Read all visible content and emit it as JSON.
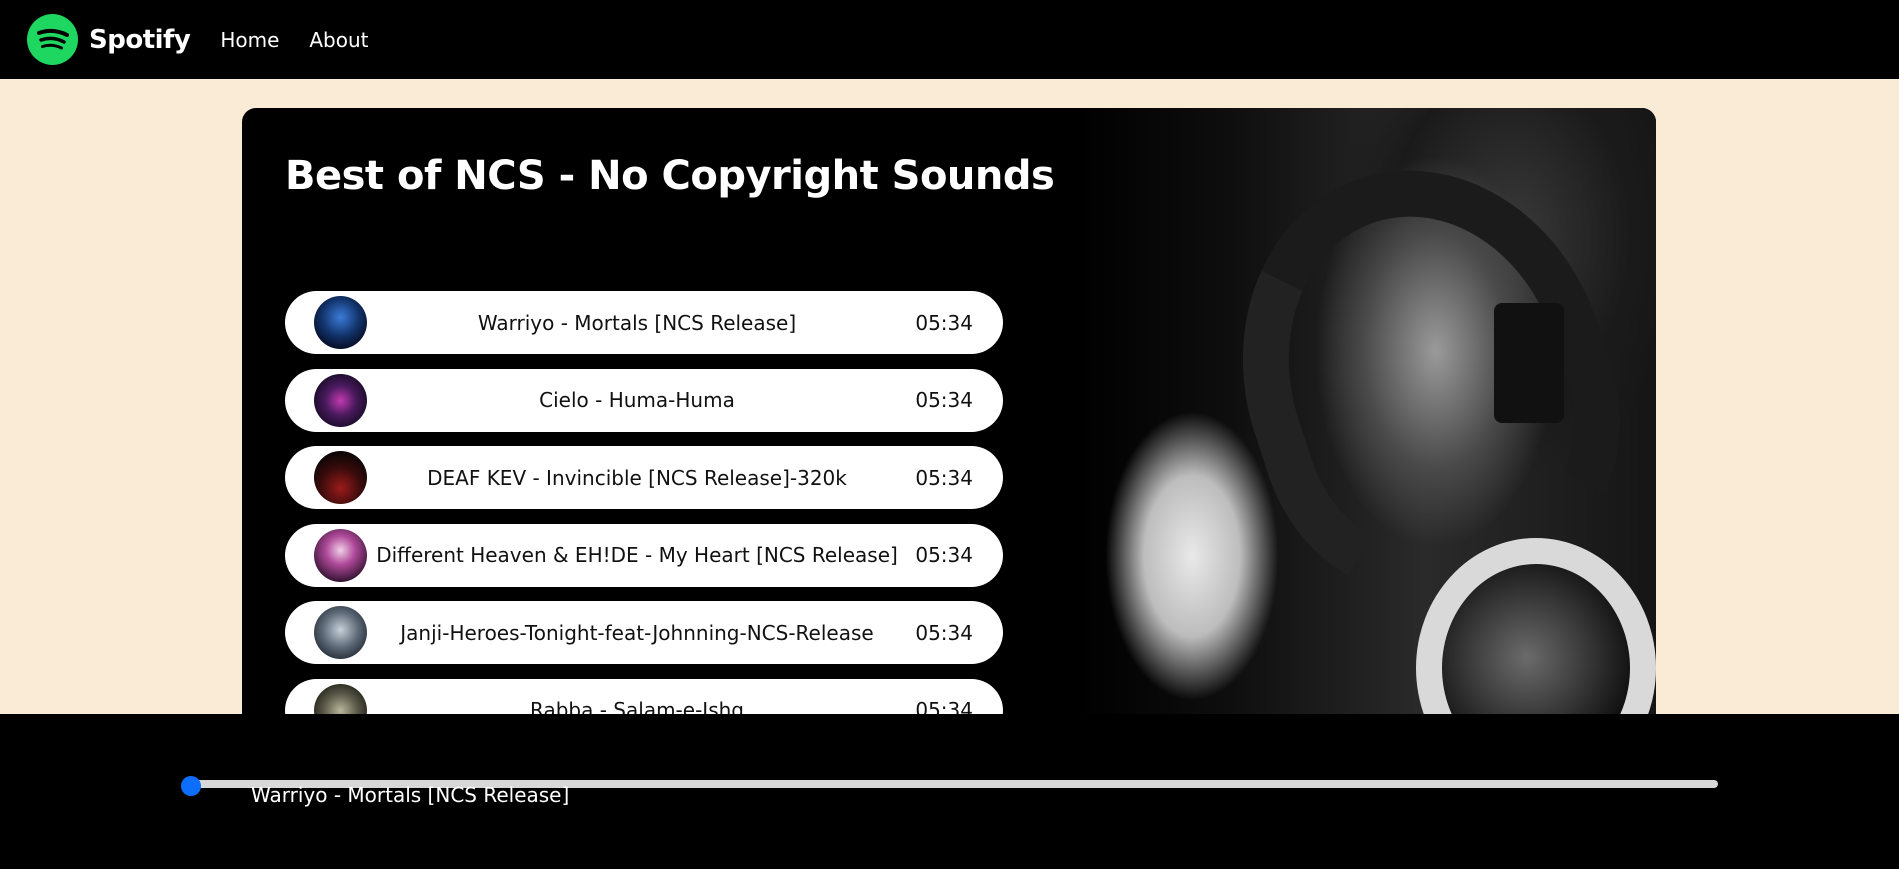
{
  "navbar": {
    "brand": "Spotify",
    "links": [
      "Home",
      "About"
    ],
    "brand_color": "#1ed760"
  },
  "playlist": {
    "title": "Best of NCS - No Copyright Sounds",
    "songs": [
      {
        "name": "Warriyo - Mortals [NCS Release]",
        "duration": "05:34",
        "cover": "blue-face-cover"
      },
      {
        "name": "Cielo - Huma-Huma",
        "duration": "05:34",
        "cover": "purple-neon-cover"
      },
      {
        "name": "DEAF KEV - Invincible [NCS Release]-320k",
        "duration": "05:34",
        "cover": "red-dark-cover"
      },
      {
        "name": "Different Heaven & EH!DE - My Heart [NCS Release]",
        "duration": "05:34",
        "cover": "pink-figure-cover"
      },
      {
        "name": "Janji-Heroes-Tonight-feat-Johnning-NCS-Release",
        "duration": "05:34",
        "cover": "grey-figure-cover"
      },
      {
        "name": "Rabba - Salam-e-Ishq",
        "duration": "05:34",
        "cover": "safety-cover"
      }
    ]
  },
  "player": {
    "now_playing": "Warriyo - Mortals [NCS Release]",
    "progress_percent": 0,
    "accent": "#0d6efd"
  }
}
